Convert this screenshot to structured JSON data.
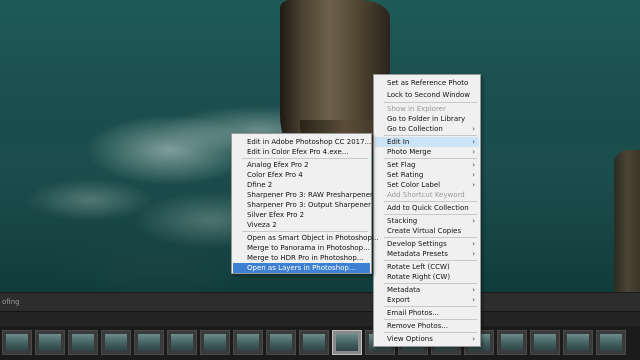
{
  "toolbar": {
    "label": "ofing"
  },
  "context_menu": {
    "items": [
      {
        "label": "Set as Reference Photo",
        "disabled": false,
        "submenu": false
      },
      {
        "label": "Lock to Second Window",
        "disabled": false,
        "submenu": false
      },
      {
        "label": "Show in Explorer",
        "disabled": true,
        "submenu": false
      },
      {
        "label": "Go to Folder in Library",
        "disabled": false,
        "submenu": false
      },
      {
        "label": "Go to Collection",
        "disabled": false,
        "submenu": true
      },
      {
        "label": "Edit In",
        "disabled": false,
        "submenu": true,
        "highlighted": true
      },
      {
        "label": "Photo Merge",
        "disabled": false,
        "submenu": true
      },
      {
        "label": "Set Flag",
        "disabled": false,
        "submenu": true
      },
      {
        "label": "Set Rating",
        "disabled": false,
        "submenu": true
      },
      {
        "label": "Set Color Label",
        "disabled": false,
        "submenu": true
      },
      {
        "label": "Add Shortcut Keyword",
        "disabled": true,
        "submenu": false
      },
      {
        "label": "Add to Quick Collection",
        "disabled": false,
        "submenu": false
      },
      {
        "label": "Stacking",
        "disabled": false,
        "submenu": true
      },
      {
        "label": "Create Virtual Copies",
        "disabled": false,
        "submenu": false
      },
      {
        "label": "Develop Settings",
        "disabled": false,
        "submenu": true
      },
      {
        "label": "Metadata Presets",
        "disabled": false,
        "submenu": true
      },
      {
        "label": "Rotate Left (CCW)",
        "disabled": false,
        "submenu": false
      },
      {
        "label": "Rotate Right (CW)",
        "disabled": false,
        "submenu": false
      },
      {
        "label": "Metadata",
        "disabled": false,
        "submenu": true
      },
      {
        "label": "Export",
        "disabled": false,
        "submenu": true
      },
      {
        "label": "Email Photos...",
        "disabled": false,
        "submenu": false
      },
      {
        "label": "Remove Photos...",
        "disabled": false,
        "submenu": false
      },
      {
        "label": "View Options",
        "disabled": false,
        "submenu": true
      }
    ]
  },
  "edit_in_submenu": {
    "items": [
      {
        "label": "Edit in Adobe Photoshop CC 2017..."
      },
      {
        "label": "Edit in Color Efex Pro 4.exe..."
      },
      {
        "label": "Analog Efex Pro 2"
      },
      {
        "label": "Color Efex Pro 4"
      },
      {
        "label": "Dfine 2"
      },
      {
        "label": "Sharpener Pro 3: RAW Presharpener"
      },
      {
        "label": "Sharpener Pro 3: Output Sharpener"
      },
      {
        "label": "Silver Efex Pro 2"
      },
      {
        "label": "Viveza 2"
      },
      {
        "label": "Open as Smart Object in Photoshop..."
      },
      {
        "label": "Merge to Panorama in Photoshop..."
      },
      {
        "label": "Merge to HDR Pro in Photoshop..."
      },
      {
        "label": "Open as Layers in Photoshop...",
        "highlighted": true
      }
    ]
  },
  "icons": {
    "submenu_arrow": "chevron-right-icon"
  },
  "colors": {
    "submenu_highlight": "#3d7fd0",
    "menu_highlight": "#cce4f7"
  }
}
